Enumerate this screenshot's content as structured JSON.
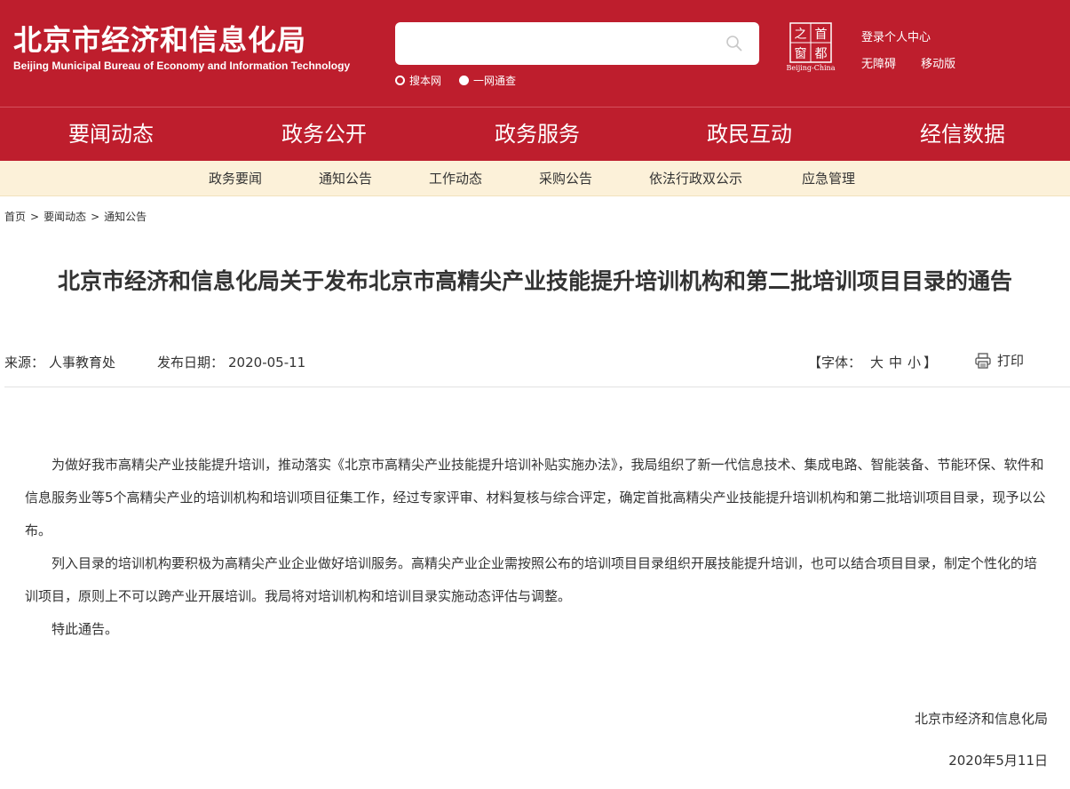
{
  "header": {
    "title": "北京市经济和信息化局",
    "subtitle": "Beijing Municipal Bureau of Economy and Information Technology",
    "search": {
      "placeholder": "",
      "value": ""
    },
    "scopes": [
      "搜本网",
      "一网通查"
    ],
    "emblem": {
      "chars": [
        "首",
        "都",
        "之",
        "窗"
      ],
      "caption": "Beijing-China"
    },
    "links": {
      "login": "登录",
      "personal_center": "个人中心",
      "accessibility": "无障碍",
      "mobile": "移动版"
    }
  },
  "main_nav": [
    "要闻动态",
    "政务公开",
    "政务服务",
    "政民互动",
    "经信数据"
  ],
  "sub_nav": [
    "政务要闻",
    "通知公告",
    "工作动态",
    "采购公告",
    "依法行政双公示",
    "应急管理"
  ],
  "breadcrumb": [
    "首页",
    "要闻动态",
    "通知公告"
  ],
  "article": {
    "title": "北京市经济和信息化局关于发布北京市高精尖产业技能提升培训机构和第二批培训项目目录的通告",
    "source_label": "来源：",
    "source": "人事教育处",
    "date_label": "发布日期：",
    "date": "2020-05-11",
    "font_label": "【字体：",
    "font_sizes": [
      "大",
      "中",
      "小"
    ],
    "font_end": "】",
    "print": "打印",
    "paragraphs": [
      "为做好我市高精尖产业技能提升培训，推动落实《北京市高精尖产业技能提升培训补贴实施办法》，我局组织了新一代信息技术、集成电路、智能装备、节能环保、软件和信息服务业等5个高精尖产业的培训机构和培训项目征集工作，经过专家评审、材料复核与综合评定，确定首批高精尖产业技能提升培训机构和第二批培训项目目录，现予以公布。",
      "列入目录的培训机构要积极为高精尖产业企业做好培训服务。高精尖产业企业需按照公布的培训项目目录组织开展技能提升培训，也可以结合项目目录，制定个性化的培训项目，原则上不可以跨产业开展培训。我局将对培训机构和培训目录实施动态评估与调整。",
      "特此通告。"
    ],
    "signature": "北京市经济和信息化局",
    "sign_date": "2020年5月11日"
  },
  "colors": {
    "brand_red": "#be1e2d",
    "subnav_bg": "#fcf1d9",
    "text": "#333333"
  },
  "icons": [
    "search-icon",
    "print-icon",
    "radio-empty-icon",
    "radio-filled-icon"
  ]
}
